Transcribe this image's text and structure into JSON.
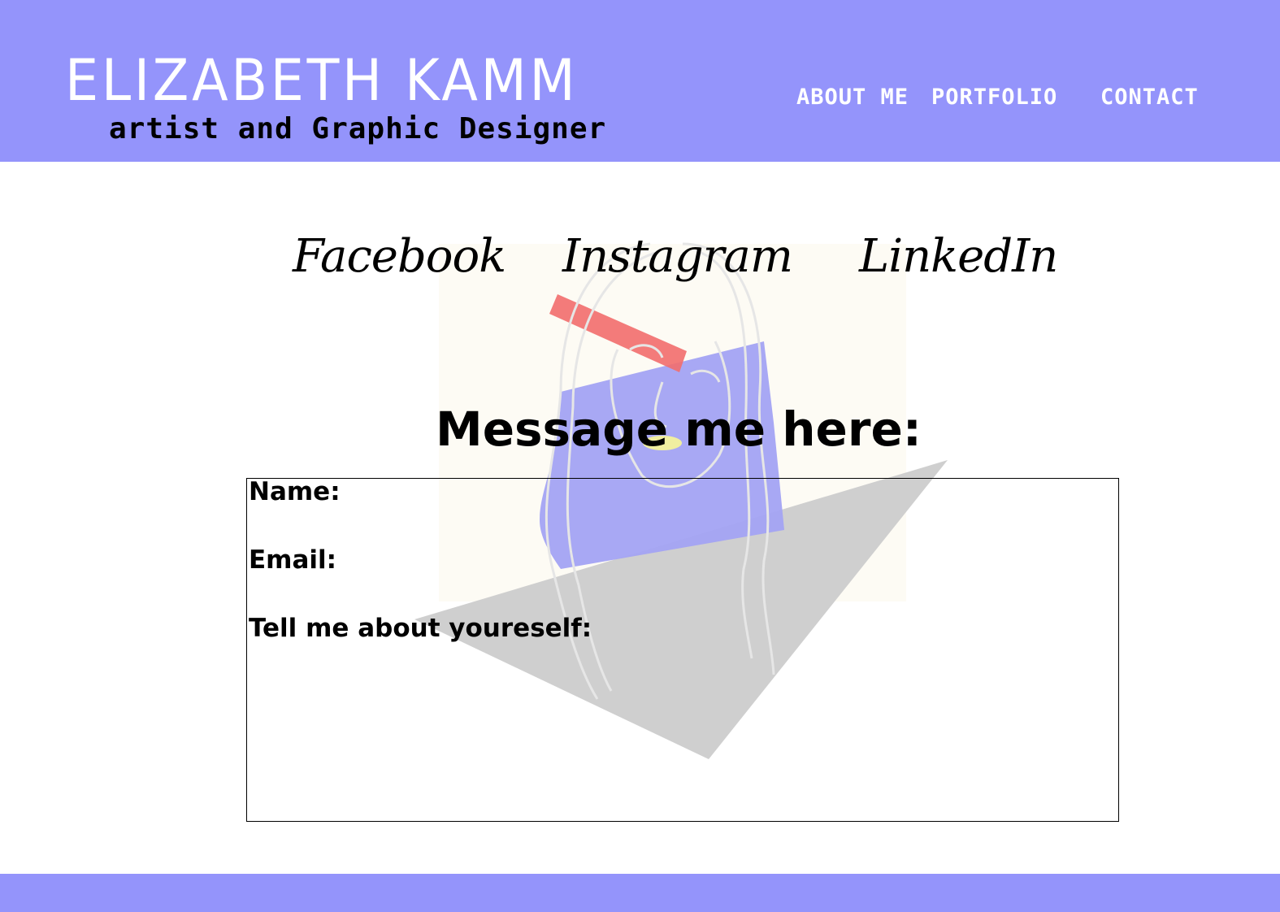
{
  "colors": {
    "accent": "#9494fb",
    "text": "#000000",
    "header_text": "#ffffff",
    "artwork_blue": "#9d9df5",
    "artwork_red": "#f06464",
    "artwork_gray": "#cccccc",
    "artwork_yellow": "#f3f3a0"
  },
  "header": {
    "brand_name": "ELIZABETH KAMM",
    "tagline": "artist and Graphic Designer",
    "nav": [
      {
        "label": "ABOUT ME"
      },
      {
        "label": "PORTFOLIO"
      },
      {
        "label": "CONTACT"
      }
    ]
  },
  "social": [
    {
      "label": "Facebook"
    },
    {
      "label": "Instagram"
    },
    {
      "label": "LinkedIn"
    }
  ],
  "main": {
    "heading": "Message me here:",
    "form": {
      "name_label": "Name:",
      "name_value": "",
      "email_label": "Email:",
      "email_value": "",
      "about_label": "Tell me about youreself:",
      "about_value": ""
    }
  }
}
